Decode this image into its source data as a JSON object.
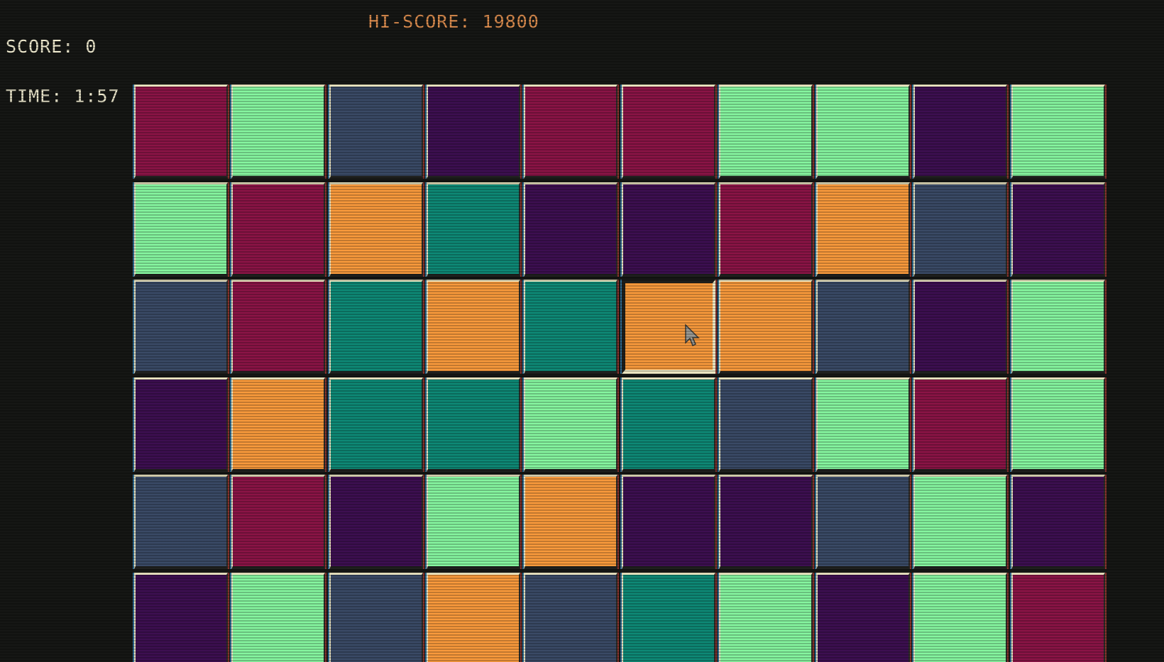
{
  "hud": {
    "hiscore_label": "HI-SCORE: 19800",
    "score_label": "SCORE: 0",
    "time_label": "TIME: 1:57"
  },
  "colors": {
    "hiscore_text": "#e08f50",
    "hud_text": "#f0ebd0",
    "background": "#161715",
    "tile_highlight": "#efe9c4"
  },
  "palette": {
    "red": "#8b1446",
    "green": "#86f6a0",
    "slate": "#3a4a66",
    "purple": "#3d0f51",
    "orange": "#f99a3c",
    "teal": "#0e8976"
  },
  "board": {
    "columns": 10,
    "rows": [
      [
        "red",
        "green",
        "slate",
        "purple",
        "red",
        "red",
        "green",
        "green",
        "purple",
        "green"
      ],
      [
        "green",
        "red",
        "orange",
        "teal",
        "purple",
        "purple",
        "red",
        "orange",
        "slate",
        "purple"
      ],
      [
        "slate",
        "red",
        "teal",
        "orange",
        "teal",
        "orange",
        "orange",
        "slate",
        "purple",
        "green"
      ],
      [
        "purple",
        "orange",
        "teal",
        "teal",
        "green",
        "teal",
        "slate",
        "green",
        "red",
        "green"
      ],
      [
        "slate",
        "red",
        "purple",
        "green",
        "orange",
        "purple",
        "purple",
        "slate",
        "green",
        "purple"
      ],
      [
        "purple",
        "green",
        "slate",
        "orange",
        "slate",
        "teal",
        "green",
        "purple",
        "green",
        "red"
      ]
    ],
    "selected": {
      "row": 2,
      "col": 5
    }
  },
  "cursor_icon": "arrow-cursor-icon"
}
